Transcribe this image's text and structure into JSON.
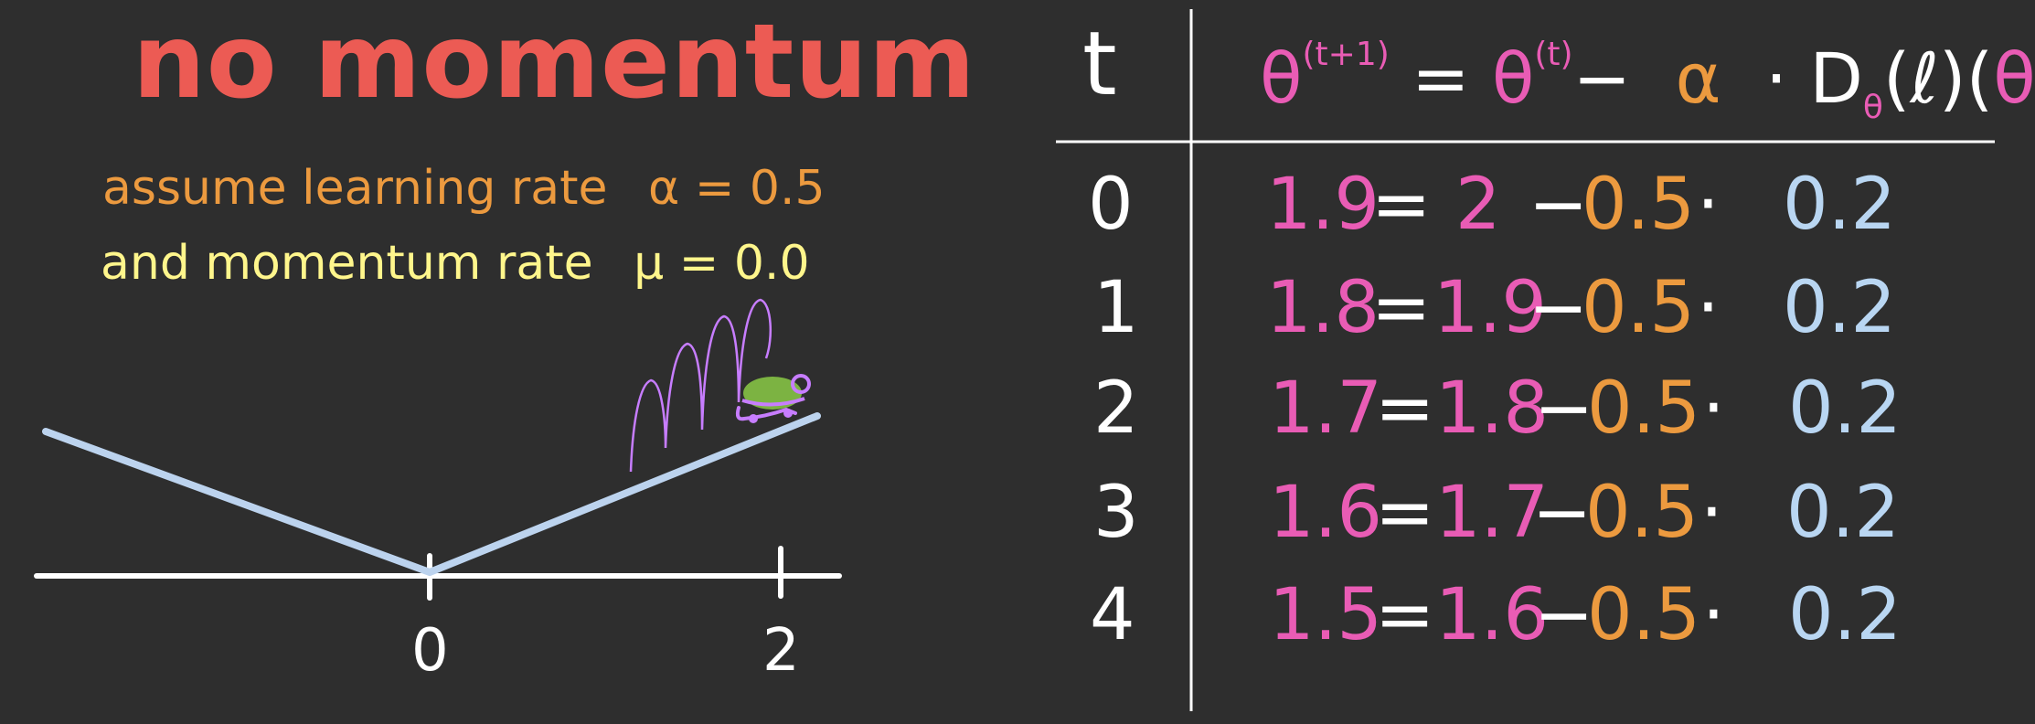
{
  "left": {
    "title": "no momentum",
    "assume_text": "assume learning rate",
    "alpha_symbol": "α",
    "alpha_value": "= 0.5",
    "momentum_text": "and momentum rate",
    "mu_symbol": "μ",
    "mu_value": "= 0.0",
    "axis_labels": [
      "0",
      "2"
    ]
  },
  "table": {
    "header_t": "t",
    "header_formula": {
      "theta": "θ",
      "sup_next": "(t+1)",
      "sup_t": "(t)",
      "equals": "=",
      "minus": "−",
      "alpha": "α",
      "dot": "·",
      "grad_D": "D",
      "grad_sub": "θ",
      "loss": "(ℓ)",
      "paren_open": "(",
      "paren_close": ")"
    },
    "rows": [
      {
        "t": "0",
        "new": "1.9",
        "old": "2",
        "lr": "0.5",
        "grad": "0.2"
      },
      {
        "t": "1",
        "new": "1.8",
        "old": "1.9",
        "lr": "0.5",
        "grad": "0.2"
      },
      {
        "t": "2",
        "new": "1.7",
        "old": "1.8",
        "lr": "0.5",
        "grad": "0.2"
      },
      {
        "t": "3",
        "new": "1.6",
        "old": "1.7",
        "lr": "0.5",
        "grad": "0.2"
      },
      {
        "t": "4",
        "new": "1.5",
        "old": "1.6",
        "lr": "0.5",
        "grad": "0.2"
      }
    ],
    "eq_sign": "=",
    "minus_sign": "−",
    "dot_sign": "·"
  },
  "colors": {
    "background": "#2e2e2e",
    "title": "#ec5b54",
    "orange": "#ec9a3f",
    "yellow": "#fff68c",
    "pink": "#e95cb5",
    "blue": "#b9d6f2",
    "curve": "#bcd3ee",
    "turtle_shell": "#7cb342",
    "turtle_body": "#c77dff"
  }
}
